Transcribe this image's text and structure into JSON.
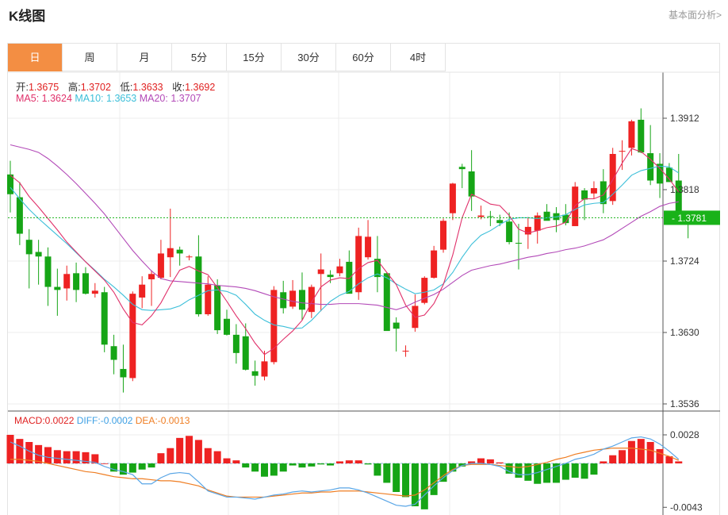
{
  "header": {
    "title": "K线图",
    "fundamental_link": "基本面分析>"
  },
  "tabs": [
    {
      "label": "日",
      "active": true
    },
    {
      "label": "周",
      "active": false
    },
    {
      "label": "月",
      "active": false
    },
    {
      "label": "5分",
      "active": false
    },
    {
      "label": "15分",
      "active": false
    },
    {
      "label": "30分",
      "active": false
    },
    {
      "label": "60分",
      "active": false
    },
    {
      "label": "4时",
      "active": false
    }
  ],
  "ohlc": {
    "open_label": "开:",
    "open": "1.3675",
    "high_label": "高:",
    "high": "1.3702",
    "low_label": "低:",
    "low": "1.3633",
    "close_label": "收:",
    "close": "1.3692"
  },
  "ma_legend": {
    "ma5_label": "MA5:",
    "ma5": "1.3624",
    "ma10_label": "MA10:",
    "ma10": "1.3653",
    "ma20_label": "MA20:",
    "ma20": "1.3707"
  },
  "macd_legend": {
    "macd_label": "MACD:",
    "macd": "0.0022",
    "diff_label": "DIFF:",
    "diff": "-0.0002",
    "dea_label": "DEA:",
    "dea": "-0.0013"
  },
  "colors": {
    "up": "#ee2222",
    "down": "#16a516",
    "ma5": "#e0306a",
    "ma10": "#3cbfd9",
    "ma20": "#b34ab8",
    "diff": "#5aa6e6",
    "dea": "#ef7d22",
    "current_price_bg": "#19b219",
    "tab_active": "#f38e43",
    "ohlc_value": "#e02020"
  },
  "chart_data": {
    "type": "candlestick",
    "price_axis": {
      "ticks": [
        "1.3912",
        "1.3818",
        "1.3724",
        "1.3630",
        "1.3536"
      ],
      "range": [
        1.3526,
        1.4
      ]
    },
    "current_price": "1.3781",
    "candles": [
      [
        1.3838,
        1.3856,
        1.3788,
        1.3812
      ],
      [
        1.3808,
        1.3828,
        1.3745,
        1.376
      ],
      [
        1.3752,
        1.3766,
        1.3688,
        1.3733
      ],
      [
        1.3736,
        1.3752,
        1.3693,
        1.373
      ],
      [
        1.373,
        1.3742,
        1.3665,
        1.369
      ],
      [
        1.369,
        1.3714,
        1.3652,
        1.3686
      ],
      [
        1.3688,
        1.3718,
        1.3672,
        1.3707
      ],
      [
        1.3708,
        1.3722,
        1.367,
        1.3686
      ],
      [
        1.3708,
        1.3716,
        1.368,
        1.3681
      ],
      [
        1.3681,
        1.3695,
        1.3676,
        1.3685
      ],
      [
        1.3683,
        1.369,
        1.3604,
        1.3614
      ],
      [
        1.3612,
        1.3627,
        1.3575,
        1.3594
      ],
      [
        1.3582,
        1.3614,
        1.3551,
        1.3571
      ],
      [
        1.357,
        1.3684,
        1.3566,
        1.3681
      ],
      [
        1.3676,
        1.3704,
        1.3662,
        1.3693
      ],
      [
        1.37,
        1.3712,
        1.3665,
        1.3707
      ],
      [
        1.3702,
        1.3752,
        1.37,
        1.3734
      ],
      [
        1.3729,
        1.3793,
        1.3703,
        1.3741
      ],
      [
        1.3739,
        1.3743,
        1.3718,
        1.3734
      ],
      [
        1.3729,
        1.3732,
        1.3725,
        1.373
      ],
      [
        1.373,
        1.3758,
        1.3651,
        1.3654
      ],
      [
        1.3654,
        1.3704,
        1.3652,
        1.3693
      ],
      [
        1.3692,
        1.37,
        1.3628,
        1.3633
      ],
      [
        1.3648,
        1.366,
        1.3626,
        1.3627
      ],
      [
        1.3627,
        1.3641,
        1.3589,
        1.3603
      ],
      [
        1.3625,
        1.3642,
        1.358,
        1.3581
      ],
      [
        1.3579,
        1.3593,
        1.356,
        1.3573
      ],
      [
        1.3572,
        1.3606,
        1.3567,
        1.3592
      ],
      [
        1.3591,
        1.3691,
        1.3588,
        1.3686
      ],
      [
        1.3683,
        1.3698,
        1.3655,
        1.3662
      ],
      [
        1.3664,
        1.3699,
        1.3661,
        1.3685
      ],
      [
        1.3686,
        1.3709,
        1.3646,
        1.366
      ],
      [
        1.3657,
        1.3693,
        1.3649,
        1.369
      ],
      [
        1.3707,
        1.3734,
        1.3658,
        1.3713
      ],
      [
        1.3706,
        1.3712,
        1.3695,
        1.3703
      ],
      [
        1.3708,
        1.3727,
        1.3704,
        1.3717
      ],
      [
        1.3723,
        1.3738,
        1.3688,
        1.3681
      ],
      [
        1.3683,
        1.3768,
        1.3673,
        1.3757
      ],
      [
        1.3729,
        1.3778,
        1.3726,
        1.3756
      ],
      [
        1.3727,
        1.3757,
        1.3683,
        1.3703
      ],
      [
        1.3708,
        1.3709,
        1.3634,
        1.3632
      ],
      [
        1.3643,
        1.365,
        1.3605,
        1.3635
      ],
      [
        1.3605,
        1.3613,
        1.3598,
        1.3606
      ],
      [
        1.3636,
        1.368,
        1.3631,
        1.3665
      ],
      [
        1.3669,
        1.3704,
        1.3667,
        1.3702
      ],
      [
        1.3702,
        1.3744,
        1.3701,
        1.3738
      ],
      [
        1.3739,
        1.378,
        1.3735,
        1.3777
      ],
      [
        1.3787,
        1.3827,
        1.3778,
        1.3826
      ],
      [
        1.3848,
        1.3852,
        1.382,
        1.3845
      ],
      [
        1.3842,
        1.387,
        1.379,
        1.3809
      ],
      [
        1.3782,
        1.3797,
        1.3779,
        1.3784
      ],
      [
        1.3783,
        1.379,
        1.377,
        1.3782
      ],
      [
        1.3778,
        1.3785,
        1.377,
        1.3774
      ],
      [
        1.3776,
        1.3788,
        1.3746,
        1.3749
      ],
      [
        1.3748,
        1.3773,
        1.3713,
        1.3747
      ],
      [
        1.3759,
        1.3782,
        1.374,
        1.3769
      ],
      [
        1.3764,
        1.3788,
        1.3747,
        1.3784
      ],
      [
        1.3789,
        1.3799,
        1.3785,
        1.3777
      ],
      [
        1.3787,
        1.3795,
        1.3762,
        1.3778
      ],
      [
        1.3785,
        1.3799,
        1.3771,
        1.3774
      ],
      [
        1.377,
        1.3828,
        1.377,
        1.3822
      ],
      [
        1.3817,
        1.382,
        1.3778,
        1.3805
      ],
      [
        1.3813,
        1.3829,
        1.3806,
        1.382
      ],
      [
        1.3829,
        1.3845,
        1.3787,
        1.3799
      ],
      [
        1.3803,
        1.3873,
        1.3798,
        1.3865
      ],
      [
        1.3868,
        1.3883,
        1.3844,
        1.3869
      ],
      [
        1.3873,
        1.391,
        1.3863,
        1.3908
      ],
      [
        1.391,
        1.3925,
        1.3866,
        1.3867
      ],
      [
        1.3866,
        1.3903,
        1.3824,
        1.383
      ],
      [
        1.3852,
        1.3866,
        1.3807,
        1.3826
      ],
      [
        1.3847,
        1.3853,
        1.3828,
        1.3828
      ],
      [
        1.383,
        1.3865,
        1.3783,
        1.3785
      ],
      [
        1.3783,
        1.3788,
        1.3754,
        1.3777
      ]
    ],
    "ma5": [
      1.3837,
      1.3827,
      1.3809,
      1.3795,
      1.378,
      1.3765,
      1.3749,
      1.3736,
      1.3723,
      1.3711,
      1.3699,
      1.3683,
      1.3661,
      1.3643,
      1.364,
      1.3652,
      1.3669,
      1.3692,
      1.3712,
      1.3717,
      1.3711,
      1.3706,
      1.3689,
      1.3671,
      1.3652,
      1.3635,
      1.3616,
      1.3601,
      1.3609,
      1.3621,
      1.3632,
      1.3646,
      1.367,
      1.369,
      1.3699,
      1.3702,
      1.3701,
      1.3714,
      1.3722,
      1.3725,
      1.3709,
      1.3693,
      1.3666,
      1.365,
      1.3653,
      1.3668,
      1.3693,
      1.3732,
      1.3781,
      1.3812,
      1.3806,
      1.3799,
      1.3797,
      1.3784,
      1.3766,
      1.3761,
      1.3764,
      1.3768,
      1.377,
      1.3775,
      1.3797,
      1.3806,
      1.3806,
      1.3811,
      1.3831,
      1.3853,
      1.3872,
      1.3868,
      1.3858,
      1.3846,
      1.3832,
      1.3815
    ],
    "ma10": [
      1.3821,
      1.3806,
      1.3792,
      1.378,
      1.3769,
      1.3758,
      1.3747,
      1.3735,
      1.3723,
      1.3712,
      1.37,
      1.369,
      1.3679,
      1.3667,
      1.366,
      1.3659,
      1.366,
      1.3661,
      1.3665,
      1.3673,
      1.3679,
      1.3685,
      1.3686,
      1.3684,
      1.3679,
      1.3667,
      1.3654,
      1.3646,
      1.364,
      1.3638,
      1.3635,
      1.3636,
      1.3646,
      1.3659,
      1.3671,
      1.3679,
      1.3684,
      1.3694,
      1.3702,
      1.3707,
      1.3702,
      1.3694,
      1.3687,
      1.3681,
      1.3683,
      1.3686,
      1.3694,
      1.3709,
      1.3729,
      1.3746,
      1.3758,
      1.3764,
      1.3772,
      1.3779,
      1.3781,
      1.3781,
      1.378,
      1.3781,
      1.3782,
      1.3785,
      1.3792,
      1.3798,
      1.38,
      1.3801,
      1.3812,
      1.3824,
      1.3837,
      1.3843,
      1.3846,
      1.3849,
      1.3848,
      1.384
    ],
    "ma20": [
      1.3877,
      1.3874,
      1.3871,
      1.3867,
      1.3859,
      1.3849,
      1.3838,
      1.3826,
      1.3813,
      1.38,
      1.3786,
      1.377,
      1.3754,
      1.3738,
      1.3724,
      1.3711,
      1.3701,
      1.3698,
      1.3697,
      1.3696,
      1.3695,
      1.3694,
      1.3692,
      1.3691,
      1.369,
      1.3688,
      1.3685,
      1.3681,
      1.3677,
      1.3674,
      1.3671,
      1.3669,
      1.3668,
      1.3667,
      1.3667,
      1.3668,
      1.3668,
      1.3668,
      1.3667,
      1.3666,
      1.3663,
      1.366,
      1.3664,
      1.367,
      1.3675,
      1.368,
      1.3687,
      1.3696,
      1.3705,
      1.3712,
      1.3715,
      1.3718,
      1.372,
      1.3723,
      1.3726,
      1.3729,
      1.3731,
      1.3734,
      1.3736,
      1.3739,
      1.3741,
      1.3744,
      1.3748,
      1.3752,
      1.3759,
      1.3767,
      1.3775,
      1.3783,
      1.3789,
      1.3796,
      1.38,
      1.3802
    ],
    "macd_axis": {
      "ticks": [
        "0.0028",
        "-0.0043"
      ],
      "range": [
        -0.005,
        0.0033
      ]
    },
    "macd_hist": [
      0.0028,
      0.0024,
      0.0021,
      0.0018,
      0.0016,
      0.0013,
      0.0012,
      0.0012,
      0.0011,
      0.0009,
      0.0,
      -0.0008,
      -0.0011,
      -0.0009,
      -0.0006,
      -0.0004,
      0.001,
      0.0015,
      0.0025,
      0.0027,
      0.0023,
      0.0015,
      0.0012,
      0.0005,
      0.0003,
      -0.0004,
      -0.0008,
      -0.0013,
      -0.0012,
      -0.0008,
      -0.0002,
      -0.0004,
      -0.0003,
      -0.0001,
      -0.0002,
      0.0002,
      0.0003,
      0.0003,
      -0.0001,
      -0.0012,
      -0.0019,
      -0.0028,
      -0.0033,
      -0.0042,
      -0.0045,
      -0.0031,
      -0.0018,
      -0.0008,
      -0.0003,
      0.0002,
      0.0005,
      0.0004,
      0.0001,
      -0.001,
      -0.0014,
      -0.0017,
      -0.002,
      -0.0019,
      -0.0019,
      -0.0016,
      -0.0014,
      -0.0015,
      -0.0011,
      0.0002,
      0.0008,
      0.0013,
      0.0022,
      0.0024,
      0.0021,
      0.0014,
      0.0007,
      0.0002
    ],
    "diff": [
      0.0021,
      0.0017,
      0.0012,
      0.0008,
      0.0006,
      0.0005,
      0.0004,
      0.0003,
      0.0002,
      0.0001,
      -0.0003,
      -0.0006,
      -0.0008,
      -0.0011,
      -0.002,
      -0.002,
      -0.0014,
      -0.001,
      -0.0009,
      -0.001,
      -0.0018,
      -0.0027,
      -0.003,
      -0.0033,
      -0.0033,
      -0.0034,
      -0.0035,
      -0.0033,
      -0.0031,
      -0.003,
      -0.0028,
      -0.0027,
      -0.0028,
      -0.0027,
      -0.0026,
      -0.0024,
      -0.0024,
      -0.0026,
      -0.0029,
      -0.0033,
      -0.0037,
      -0.0041,
      -0.0042,
      -0.004,
      -0.0031,
      -0.0022,
      -0.0014,
      -0.0007,
      -0.0002,
      0.0,
      0.0,
      -0.0001,
      -0.0003,
      -0.0008,
      -0.0011,
      -0.0011,
      -0.0009,
      -0.0006,
      -0.0003,
      0.0,
      0.0004,
      0.0006,
      0.0009,
      0.0014,
      0.0017,
      0.0021,
      0.0025,
      0.0026,
      0.0024,
      0.0019,
      0.0012,
      0.0004
    ],
    "dea": [
      0.0004,
      0.0004,
      0.0003,
      0.0002,
      0.0,
      -0.0002,
      -0.0004,
      -0.0006,
      -0.0008,
      -0.0009,
      -0.0011,
      -0.0013,
      -0.0014,
      -0.0015,
      -0.0015,
      -0.0016,
      -0.0017,
      -0.0017,
      -0.0018,
      -0.002,
      -0.0022,
      -0.0026,
      -0.0029,
      -0.0032,
      -0.0033,
      -0.0033,
      -0.0033,
      -0.0033,
      -0.0032,
      -0.0031,
      -0.003,
      -0.0029,
      -0.0029,
      -0.0028,
      -0.0028,
      -0.0027,
      -0.0027,
      -0.0027,
      -0.0028,
      -0.0029,
      -0.003,
      -0.0031,
      -0.0032,
      -0.0031,
      -0.0026,
      -0.0019,
      -0.0012,
      -0.0006,
      -0.0002,
      -0.0001,
      -0.0001,
      -0.0001,
      -0.0002,
      -0.0003,
      -0.0004,
      -0.0003,
      -0.0001,
      0.0001,
      0.0004,
      0.0006,
      0.0009,
      0.0011,
      0.0013,
      0.0014,
      0.0015,
      0.0015,
      0.0015,
      0.0014,
      0.0013,
      0.001,
      0.0007,
      0.0003
    ]
  }
}
